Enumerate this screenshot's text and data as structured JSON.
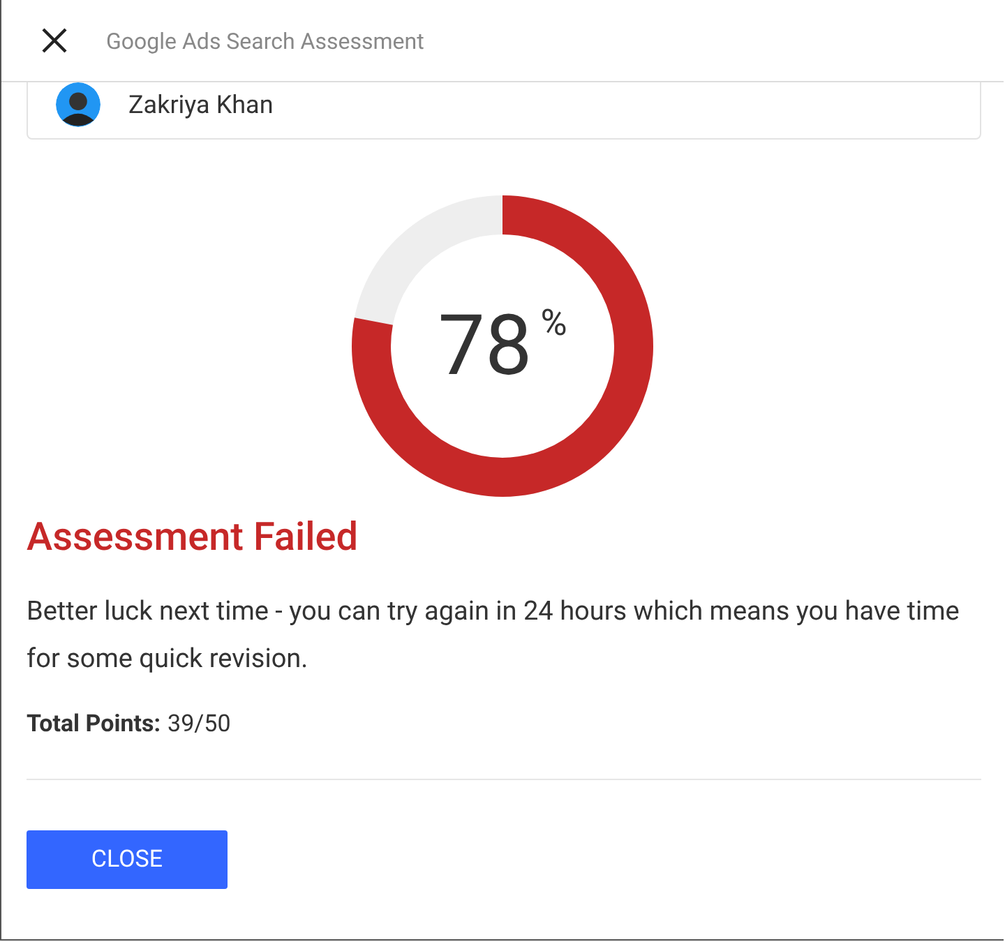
{
  "header": {
    "title": "Google Ads Search Assessment"
  },
  "user": {
    "name": "Zakriya Khan"
  },
  "score": {
    "value": "78",
    "unit": "%",
    "level": 0.78
  },
  "result": {
    "title": "Assessment Failed",
    "message": "Better luck next time - you can try again in 24 hours which means you have time for some quick revision.",
    "points_label": "Total Points:",
    "points_value": "39/50"
  },
  "buttons": [
    "CLOSE"
  ]
}
